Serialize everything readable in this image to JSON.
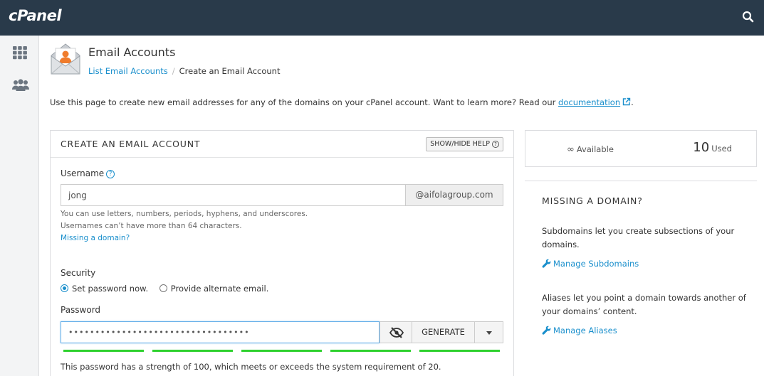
{
  "app": {
    "logo_text": "cPanel",
    "top_icons": [
      "search-icon"
    ],
    "rail_icons": [
      "apps-grid-icon",
      "users-icon"
    ],
    "accent_color": "#1a8fcc",
    "header_bg": "#293a4a"
  },
  "page": {
    "title": "Email Accounts",
    "breadcrumb": {
      "link": "List Email Accounts",
      "separator": "/",
      "current": "Create an Email Account"
    },
    "intro_text": "Use this page to create new email addresses for any of the domains on your cPanel account. Want to learn more? Read our ",
    "intro_link": "documentation",
    "intro_end": "."
  },
  "form": {
    "title": "CREATE AN EMAIL ACCOUNT",
    "help_button": "SHOW/HIDE HELP",
    "username_label": "Username",
    "username_value": "jong",
    "domain": "@aifolagroup.com",
    "hint_line1": "You can use letters, numbers, periods, hyphens, and underscores.",
    "hint_line2": "Usernames can’t have more than 64 characters.",
    "missing_domain_link": "Missing a domain?",
    "security_label": "Security",
    "security_options": [
      "Set password now.",
      "Provide alternate email."
    ],
    "security_selected": "Set password now.",
    "password_label": "Password",
    "password_value": "••••••••••••••••••••••••••••••••••",
    "generate_button": "GENERATE",
    "strength_value": 100,
    "strength_color": "#2ed12e",
    "strength_text": "This password has a strength of 100, which meets or exceeds the system requirement of 20."
  },
  "stats": {
    "available_symbol": "∞",
    "available_label": "Available",
    "used_count": "10",
    "used_label": "Used"
  },
  "sidebar": {
    "title": "MISSING A DOMAIN?",
    "subdomains_text": "Subdomains let you create subsections of your domains.",
    "subdomains_link": "Manage Subdomains",
    "aliases_text": "Aliases let you point a domain towards another of your domains’ content.",
    "aliases_link": "Manage Aliases"
  }
}
